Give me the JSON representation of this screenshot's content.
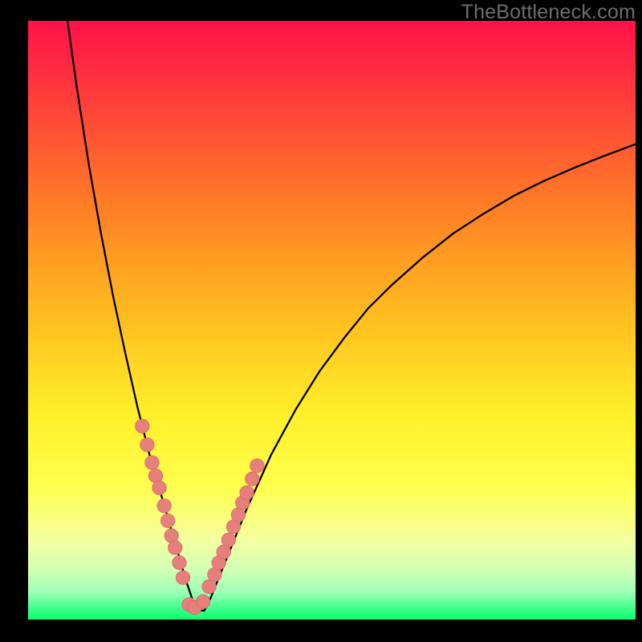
{
  "watermark": "TheBottleneck.com",
  "colors": {
    "frame": "#000000",
    "gradient_top": "#ff1249",
    "gradient_mid": "#ffa31d",
    "gradient_low": "#ffff46",
    "gradient_pale": "#f5ffb1",
    "gradient_bottom": "#09ff69",
    "curve": "#000000",
    "marker_fill": "#e77f7d",
    "marker_stroke": "#d96c6a"
  },
  "chart_data": {
    "type": "line",
    "title": "",
    "xlabel": "",
    "ylabel": "",
    "xlim": [
      0,
      100
    ],
    "ylim": [
      0,
      100
    ],
    "series": [
      {
        "name": "curve",
        "x": [
          6.5,
          8,
          10,
          12,
          14,
          16,
          18,
          20,
          21,
          22,
          23,
          24,
          25,
          26,
          27,
          28,
          29,
          30,
          32,
          34,
          36,
          38,
          40,
          44,
          48,
          52,
          56,
          60,
          65,
          70,
          75,
          80,
          85,
          90,
          95,
          100
        ],
        "y": [
          100,
          89,
          76,
          64.5,
          54,
          44.5,
          35.5,
          27.5,
          24,
          20.5,
          17,
          13.5,
          10,
          6.5,
          3.5,
          1.5,
          1.5,
          3.5,
          8.5,
          13.5,
          18.5,
          23,
          27.5,
          35,
          41.5,
          47,
          52,
          56,
          60.5,
          64.5,
          67.8,
          70.8,
          73.3,
          75.5,
          77.5,
          79.4
        ]
      }
    ],
    "markers": {
      "name": "highlight-dots",
      "x": [
        18.8,
        19.6,
        20.4,
        21.0,
        21.6,
        22.4,
        23.0,
        23.6,
        24.2,
        24.9,
        25.5,
        26.5,
        27.4,
        28.8,
        29.8,
        30.7,
        31.4,
        32.2,
        33.0,
        33.8,
        34.6,
        35.3,
        36.0,
        36.9,
        37.7
      ],
      "y": [
        32.3,
        29.2,
        26.2,
        24.0,
        22.0,
        19.0,
        16.5,
        14.0,
        12.0,
        9.5,
        7.0,
        2.5,
        2.0,
        3.0,
        5.5,
        7.5,
        9.5,
        11.3,
        13.3,
        15.5,
        17.5,
        19.5,
        21.2,
        23.5,
        25.7
      ]
    }
  }
}
